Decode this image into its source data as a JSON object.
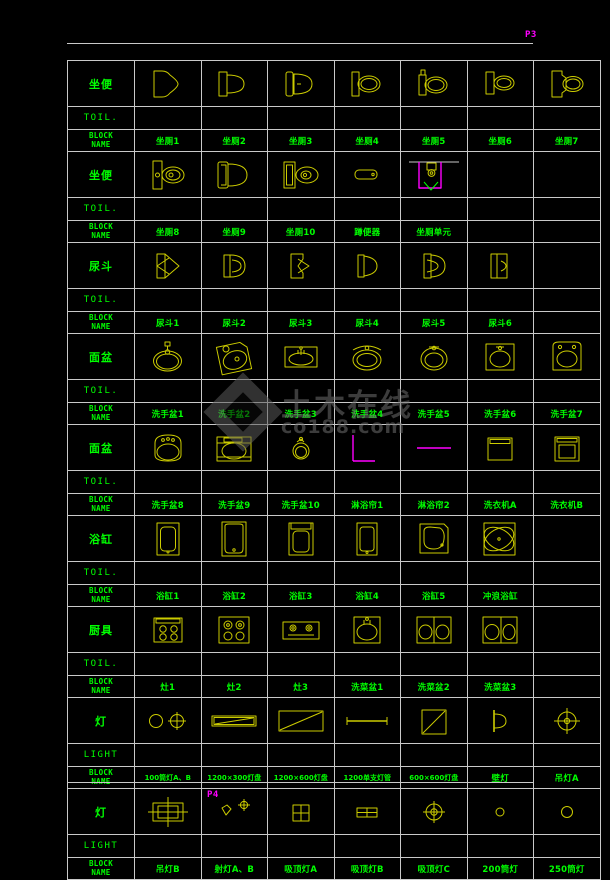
{
  "document": {
    "page_code_top": "P3",
    "page_code_bottom": "P4",
    "watermark_line1": "土木在线",
    "watermark_line2": "co188.com",
    "colors": {
      "background": "#000000",
      "grid_line": "#c9c9c9",
      "label_text": "#00ff00",
      "symbol": "#cccc00",
      "accent_magenta": "#ff00ff"
    }
  },
  "labels": {
    "block_name": "BLOCK\nNAME",
    "block_name_l1": "BLOCK",
    "block_name_l2": "NAME",
    "toil": "TOIL.",
    "light": "LIGHT"
  },
  "sections": [
    {
      "category": "坐便",
      "sub": "TOIL.",
      "names": [
        "坐厕1",
        "坐厕2",
        "坐厕3",
        "坐厕4",
        "坐厕5",
        "坐厕6",
        "坐厕7"
      ],
      "symbols": [
        "toilet-plan-1",
        "toilet-plan-2",
        "toilet-plan-3",
        "toilet-plan-4",
        "toilet-plan-5",
        "toilet-plan-6",
        "toilet-plan-7"
      ]
    },
    {
      "category": "坐便",
      "sub": "TOIL.",
      "names": [
        "坐厕8",
        "坐厕9",
        "坐厕10",
        "蹲便器",
        "坐厕单元",
        "",
        ""
      ],
      "symbols": [
        "toilet-plan-8",
        "toilet-plan-9",
        "toilet-plan-10",
        "squat-pan",
        "toilet-unit",
        "",
        ""
      ]
    },
    {
      "category": "尿斗",
      "sub": "TOIL.",
      "names": [
        "尿斗1",
        "尿斗2",
        "尿斗3",
        "尿斗4",
        "尿斗5",
        "尿斗6",
        ""
      ],
      "symbols": [
        "urinal-1",
        "urinal-2",
        "urinal-3",
        "urinal-4",
        "urinal-5",
        "urinal-6",
        ""
      ]
    },
    {
      "category": "面盆",
      "sub": "TOIL.",
      "names": [
        "洗手盆1",
        "洗手盆2",
        "洗手盆3",
        "洗手盆4",
        "洗手盆5",
        "洗手盆6",
        "洗手盆7"
      ],
      "symbols": [
        "basin-1",
        "basin-2",
        "basin-3",
        "basin-4",
        "basin-5",
        "basin-6",
        "basin-7"
      ]
    },
    {
      "category": "面盆",
      "sub": "TOIL.",
      "names": [
        "洗手盆8",
        "洗手盆9",
        "洗手盆10",
        "淋浴帘1",
        "淋浴帘2",
        "洗衣机A",
        "洗衣机B"
      ],
      "symbols": [
        "basin-8",
        "basin-9",
        "basin-10",
        "shower-curtain-1",
        "shower-curtain-2",
        "washer-a",
        "washer-b"
      ]
    },
    {
      "category": "浴缸",
      "sub": "TOIL.",
      "names": [
        "浴缸1",
        "浴缸2",
        "浴缸3",
        "浴缸4",
        "浴缸5",
        "冲浪浴缸",
        ""
      ],
      "symbols": [
        "bathtub-1",
        "bathtub-2",
        "bathtub-3",
        "bathtub-4",
        "bathtub-5",
        "jacuzzi",
        ""
      ]
    },
    {
      "category": "厨具",
      "sub": "TOIL.",
      "names": [
        "灶1",
        "灶2",
        "灶3",
        "洗菜盆1",
        "洗菜盆2",
        "洗菜盆3",
        ""
      ],
      "symbols": [
        "cooktop-1",
        "cooktop-2",
        "cooktop-3",
        "kitchen-sink-1",
        "kitchen-sink-2",
        "kitchen-sink-3",
        ""
      ]
    },
    {
      "category": "灯",
      "sub": "LIGHT",
      "names": [
        "100筒灯A、B",
        "1200×300灯盘",
        "1200×600灯盘",
        "1200单支灯管",
        "600×600灯盘",
        "壁灯",
        "吊灯A"
      ],
      "symbols": [
        "downlight-ab",
        "lamp-tray-1200x300",
        "lamp-tray-1200x600",
        "single-tube-1200",
        "lamp-tray-600x600",
        "wall-light",
        "pendant-a"
      ]
    },
    {
      "category": "灯",
      "sub": "LIGHT",
      "names": [
        "吊灯B",
        "射灯A、B",
        "吸顶灯A",
        "吸顶灯B",
        "吸顶灯C",
        "200筒灯",
        "250筒灯"
      ],
      "symbols": [
        "pendant-b",
        "spotlight-ab",
        "ceiling-light-a",
        "ceiling-light-b",
        "ceiling-light-c",
        "downlight-200",
        "downlight-250"
      ]
    }
  ]
}
